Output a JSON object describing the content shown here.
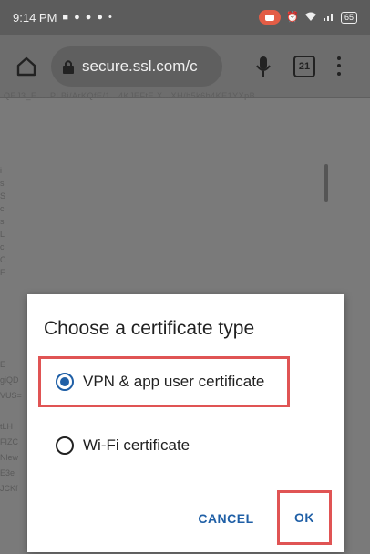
{
  "status_bar": {
    "time": "9:14 PM",
    "battery": "65"
  },
  "browser": {
    "url": "secure.ssl.com/c",
    "tab_count": "21"
  },
  "background_page": {
    "top_line": "QEJ3_E...i.PLBi/ArKQfE/1...4KJEFtE.X...XH/h5k6b4KE1YXpB",
    "left_fragments_top": [
      "i",
      "s",
      "S",
      "c",
      "s",
      "L",
      "c",
      "C",
      "F"
    ],
    "left_fragments_bottom": [
      "E",
      "giQD",
      "VUS=",
      "",
      "tLH",
      "FIZC",
      "Nlew",
      "E3e",
      "JCKf"
    ]
  },
  "dialog": {
    "title": "Choose a certificate type",
    "options": [
      {
        "label": "VPN & app user certificate",
        "selected": true
      },
      {
        "label": "Wi-Fi certificate",
        "selected": false
      }
    ],
    "cancel_label": "CANCEL",
    "ok_label": "OK"
  },
  "colors": {
    "accent": "#1f5fa6",
    "highlight_border": "#e05454",
    "scrim": "#7a7a7a"
  },
  "icons": [
    "home-icon",
    "lock-icon",
    "mic-icon",
    "tabs-icon",
    "menu-icon",
    "wifi-icon",
    "alarm-icon",
    "signal-icon",
    "battery-icon",
    "record-icon"
  ]
}
